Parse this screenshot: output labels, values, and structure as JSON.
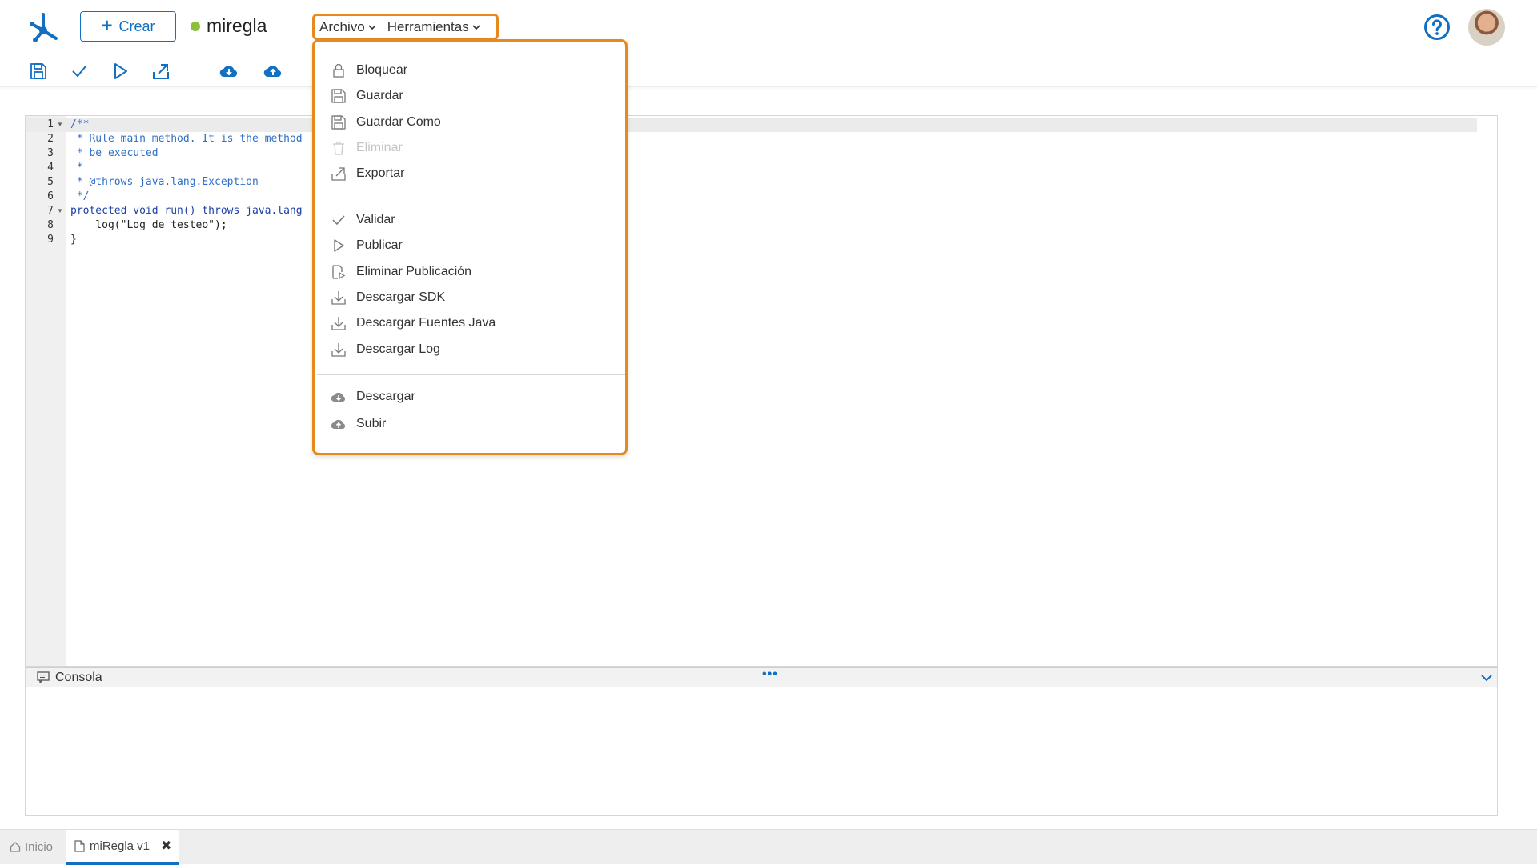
{
  "header": {
    "create_label": "Crear",
    "doc_title": "miregla",
    "status_color": "#8bbf3c",
    "accent_color": "#1170c2",
    "highlight_color": "#e8891d"
  },
  "menubar": {
    "items": [
      {
        "label": "Archivo"
      },
      {
        "label": "Herramientas"
      }
    ]
  },
  "toolbar": {
    "icons": [
      "save-icon",
      "check-icon",
      "play-icon",
      "export-icon",
      "cloud-download-icon",
      "cloud-upload-icon"
    ]
  },
  "archivo_menu": {
    "groups": [
      [
        {
          "label": "Bloquear",
          "icon": "lock-icon",
          "enabled": true
        },
        {
          "label": "Guardar",
          "icon": "save-icon",
          "enabled": true
        },
        {
          "label": "Guardar Como",
          "icon": "save-as-icon",
          "enabled": true
        },
        {
          "label": "Eliminar",
          "icon": "trash-icon",
          "enabled": false
        },
        {
          "label": "Exportar",
          "icon": "export-icon",
          "enabled": true
        }
      ],
      [
        {
          "label": "Validar",
          "icon": "check-icon",
          "enabled": true
        },
        {
          "label": "Publicar",
          "icon": "play-icon",
          "enabled": true
        },
        {
          "label": "Eliminar Publicación",
          "icon": "unpublish-icon",
          "enabled": true
        },
        {
          "label": "Descargar SDK",
          "icon": "download-icon",
          "enabled": true
        },
        {
          "label": "Descargar Fuentes Java",
          "icon": "download-icon",
          "enabled": true
        },
        {
          "label": "Descargar Log",
          "icon": "download-icon",
          "enabled": true
        }
      ],
      [
        {
          "label": "Descargar",
          "icon": "cloud-download-icon",
          "enabled": true
        },
        {
          "label": "Subir",
          "icon": "cloud-upload-icon",
          "enabled": true
        }
      ]
    ]
  },
  "editor": {
    "line_numbers": [
      "1",
      "2",
      "3",
      "4",
      "5",
      "6",
      "7",
      "8",
      "9"
    ],
    "lines": [
      "/**",
      " * Rule main method. It is the method",
      " * be executed",
      " *",
      " * @throws java.lang.Exception",
      " */",
      "protected void run() throws java.lang",
      "    log(\"Log de testeo\");",
      "}"
    ]
  },
  "console": {
    "label": "Consola",
    "dots": "•••"
  },
  "bottom_tabs": {
    "home_label": "Inicio",
    "doc_label": "miRegla v1",
    "close_glyph": "✖"
  }
}
